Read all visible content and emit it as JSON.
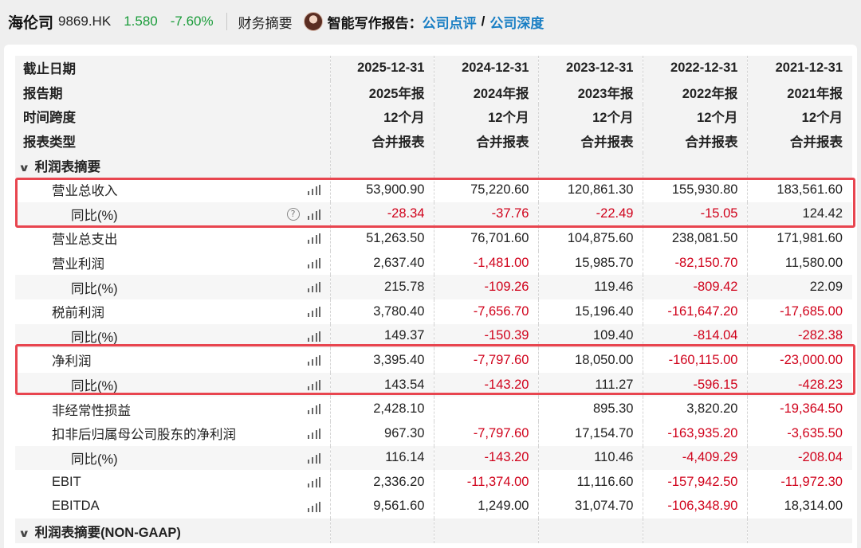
{
  "header": {
    "company_name": "海伦司",
    "ticker": "9869.HK",
    "price": "1.580",
    "change_pct": "-7.60%",
    "section": "财务摘要",
    "report_label": "智能写作报告：",
    "link1": "公司点评",
    "link_separator": "/",
    "link2": "公司深度"
  },
  "colors": {
    "up_green": "#1a9c3a",
    "negative_red": "#d0021b",
    "link_blue": "#1a7fc4",
    "highlight_red": "#e8454f"
  },
  "table": {
    "meta_rows": [
      {
        "label": "截止日期",
        "values": [
          "2025-12-31",
          "2024-12-31",
          "2023-12-31",
          "2022-12-31",
          "2021-12-31"
        ]
      },
      {
        "label": "报告期",
        "values": [
          "2025年报",
          "2024年报",
          "2023年报",
          "2022年报",
          "2021年报"
        ]
      },
      {
        "label": "时间跨度",
        "values": [
          "12个月",
          "12个月",
          "12个月",
          "12个月",
          "12个月"
        ]
      },
      {
        "label": "报表类型",
        "values": [
          "合并报表",
          "合并报表",
          "合并报表",
          "合并报表",
          "合并报表"
        ]
      }
    ],
    "section1": "利润表摘要",
    "rows": [
      {
        "label": "营业总收入",
        "level": 1,
        "values": [
          "53,900.90",
          "75,220.60",
          "120,861.30",
          "155,930.80",
          "183,561.60"
        ]
      },
      {
        "label": "同比(%)",
        "level": 2,
        "help": true,
        "values": [
          "-28.34",
          "-37.76",
          "-22.49",
          "-15.05",
          "124.42"
        ]
      },
      {
        "label": "营业总支出",
        "level": 1,
        "values": [
          "51,263.50",
          "76,701.60",
          "104,875.60",
          "238,081.50",
          "171,981.60"
        ]
      },
      {
        "label": "营业利润",
        "level": 1,
        "values": [
          "2,637.40",
          "-1,481.00",
          "15,985.70",
          "-82,150.70",
          "11,580.00"
        ]
      },
      {
        "label": "同比(%)",
        "level": 2,
        "values": [
          "215.78",
          "-109.26",
          "119.46",
          "-809.42",
          "22.09"
        ]
      },
      {
        "label": "税前利润",
        "level": 1,
        "values": [
          "3,780.40",
          "-7,656.70",
          "15,196.40",
          "-161,647.20",
          "-17,685.00"
        ]
      },
      {
        "label": "同比(%)",
        "level": 2,
        "values": [
          "149.37",
          "-150.39",
          "109.40",
          "-814.04",
          "-282.38"
        ]
      },
      {
        "label": "净利润",
        "level": 1,
        "values": [
          "3,395.40",
          "-7,797.60",
          "18,050.00",
          "-160,115.00",
          "-23,000.00"
        ]
      },
      {
        "label": "同比(%)",
        "level": 2,
        "values": [
          "143.54",
          "-143.20",
          "111.27",
          "-596.15",
          "-428.23"
        ]
      },
      {
        "label": "非经常性损益",
        "level": 1,
        "values": [
          "2,428.10",
          "",
          "895.30",
          "3,820.20",
          "-19,364.50"
        ]
      },
      {
        "label": "扣非后归属母公司股东的净利润",
        "level": 1,
        "values": [
          "967.30",
          "-7,797.60",
          "17,154.70",
          "-163,935.20",
          "-3,635.50"
        ]
      },
      {
        "label": "同比(%)",
        "level": 2,
        "values": [
          "116.14",
          "-143.20",
          "110.46",
          "-4,409.29",
          "-208.04"
        ]
      },
      {
        "label": "EBIT",
        "level": 1,
        "values": [
          "2,336.20",
          "-11,374.00",
          "11,116.60",
          "-157,942.50",
          "-11,972.30"
        ]
      },
      {
        "label": "EBITDA",
        "level": 1,
        "values": [
          "9,561.60",
          "1,249.00",
          "31,074.70",
          "-106,348.90",
          "18,314.00"
        ]
      }
    ],
    "section2": "利润表摘要(NON-GAAP)"
  }
}
